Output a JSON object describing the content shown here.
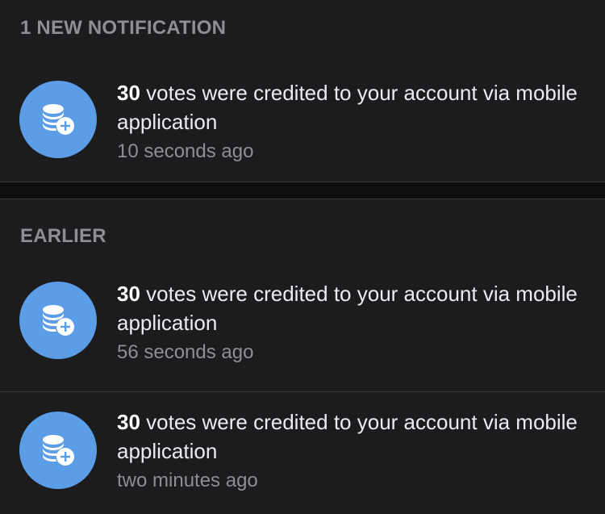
{
  "sections": [
    {
      "title": "1 NEW NOTIFICATION",
      "items": [
        {
          "count": "30",
          "message": "votes were credited to your account via mobile application",
          "time": "10 seconds ago",
          "icon": "coins-plus-icon"
        }
      ]
    },
    {
      "title": "EARLIER",
      "items": [
        {
          "count": "30",
          "message": "votes were credited to your account via mobile application",
          "time": "56 seconds ago",
          "icon": "coins-plus-icon"
        },
        {
          "count": "30",
          "message": "votes were credited to your account via mobile application",
          "time": "two minutes ago",
          "icon": "coins-plus-icon"
        }
      ]
    }
  ],
  "colors": {
    "background": "#1c1c1e",
    "accent": "#5b9de6",
    "header_text": "#8e8e93",
    "primary_text": "#ebebf0",
    "secondary_text": "#8e8e93"
  }
}
